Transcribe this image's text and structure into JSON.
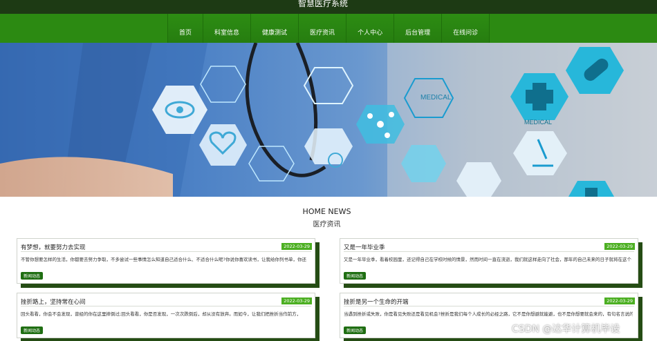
{
  "header": {
    "site_title": "智慧医疗系统"
  },
  "nav": {
    "items": [
      {
        "label": "首页"
      },
      {
        "label": "科室信息"
      },
      {
        "label": "健康测试"
      },
      {
        "label": "医疗资讯"
      },
      {
        "label": "个人中心"
      },
      {
        "label": "后台管理"
      },
      {
        "label": "在线问诊"
      }
    ]
  },
  "banner": {
    "label_medical_1": "MEDICAL",
    "label_medical_2": "MEDICAL",
    "slide_count": 3
  },
  "news": {
    "title": "HOME NEWS",
    "subtitle": "医疗资讯",
    "cards": [
      {
        "title": "有梦想，就要努力去实现",
        "date": "2022-03-29",
        "body": "不管你想要怎样的生活，你都要去努力争取，不多尝试一些事情怎么知道自己适合什么、不适合什么呢?你说你喜欢读书，让我给你列书单，你还",
        "tag": "新闻动态"
      },
      {
        "title": "又是一年毕业季",
        "date": "2022-03-29",
        "body": "又是一年毕业季，看着校园里，还记得自己在学校时候的情景，然而时间一直在流逝，我们就这样走向了社会，那年的自己未来的日子就将在这个",
        "tag": "新闻动态"
      },
      {
        "title": "挫折路上，坚持常在心间",
        "date": "2022-03-29",
        "body": "回头看看，你会不会发现，曾经的你在这里摔倒过;回头看看，你是否发现，一次次跌倒后，却从没有放弃。而如今，让我们把挫折当作前方，",
        "tag": "新闻动态"
      },
      {
        "title": "挫折是另一个生命的开端",
        "date": "2022-03-29",
        "body": "当遇到挫折或失败，你是看见失败还是看见机会?挫折是我们每个人成长的必经之路，它不是你想避就能避，也不是你想要就会来的，有句名言说的好，如",
        "tag": "新闻动态"
      }
    ]
  },
  "watermark": "CSDN @达华计算机毕设"
}
